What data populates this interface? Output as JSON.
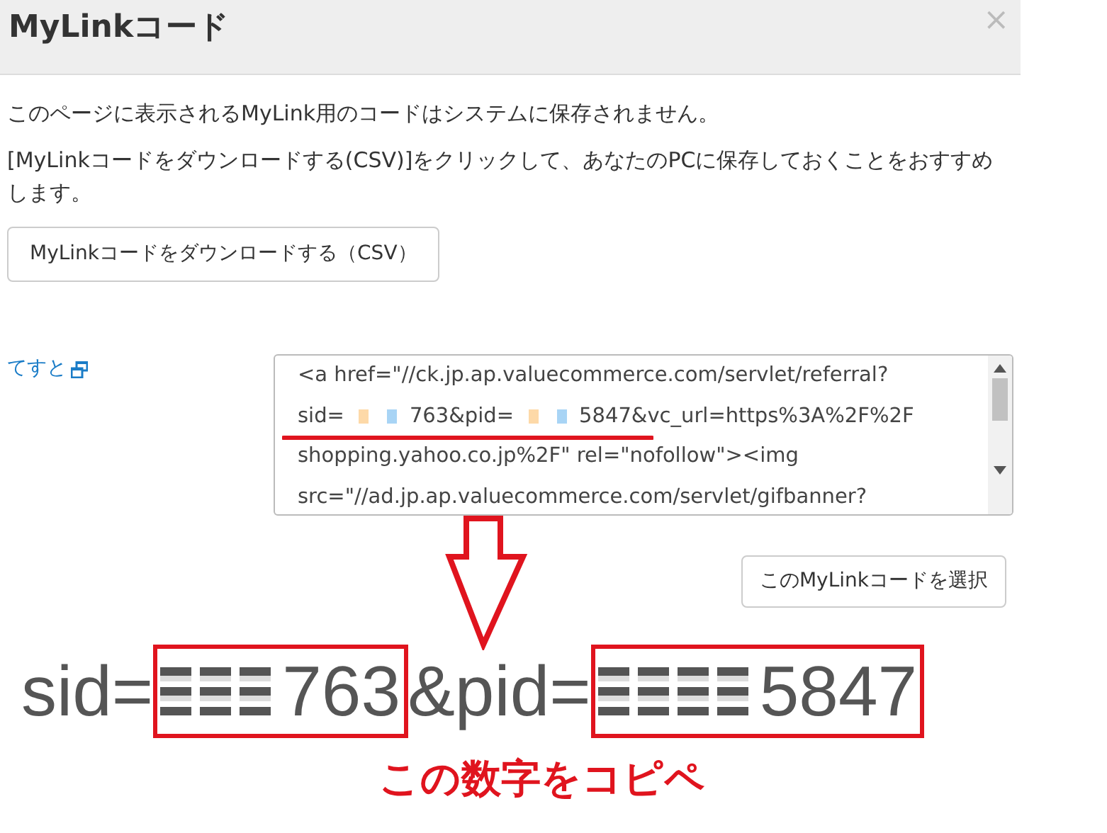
{
  "dialog": {
    "title": "MyLinkコード",
    "close": "×"
  },
  "notes": [
    "このページに表示されるMyLink用のコードはシステムに保存されません。",
    "[MyLinkコードをダウンロードする(CSV)]をクリックして、あなたのPCに保存しておくことをおすすめします。"
  ],
  "download_button": "MyLinkコードをダウンロードする（CSV）",
  "link": {
    "label": "てすと"
  },
  "code_lines": [
    {
      "segments": [
        {
          "kind": "text",
          "text": "<a href=\"//ck.jp.ap.valuecommerce.com/servlet/referral?"
        }
      ]
    },
    {
      "segments": [
        {
          "kind": "text",
          "text": "sid="
        },
        {
          "kind": "redacted"
        },
        {
          "kind": "text",
          "text": "763&pid="
        },
        {
          "kind": "redacted"
        },
        {
          "kind": "text",
          "text": "5847&vc_url=https%3A%2F%2F"
        }
      ]
    },
    {
      "segments": [
        {
          "kind": "text",
          "text": "shopping.yahoo.co.jp%2F\" rel=\"nofollow\"><img"
        }
      ]
    },
    {
      "segments": [
        {
          "kind": "text",
          "text": "src=\"//ad.jp.ap.valuecommerce.com/servlet/gifbanner?"
        }
      ]
    }
  ],
  "select_button": "このMyLinkコードを選択",
  "callout": {
    "segments": [
      {
        "kind": "text",
        "text": "sid="
      },
      {
        "kind": "boxed",
        "text": "763"
      },
      {
        "kind": "text",
        "text": "&pid="
      },
      {
        "kind": "boxed",
        "text": "5847"
      }
    ],
    "caption": "この数字をコピペ"
  }
}
